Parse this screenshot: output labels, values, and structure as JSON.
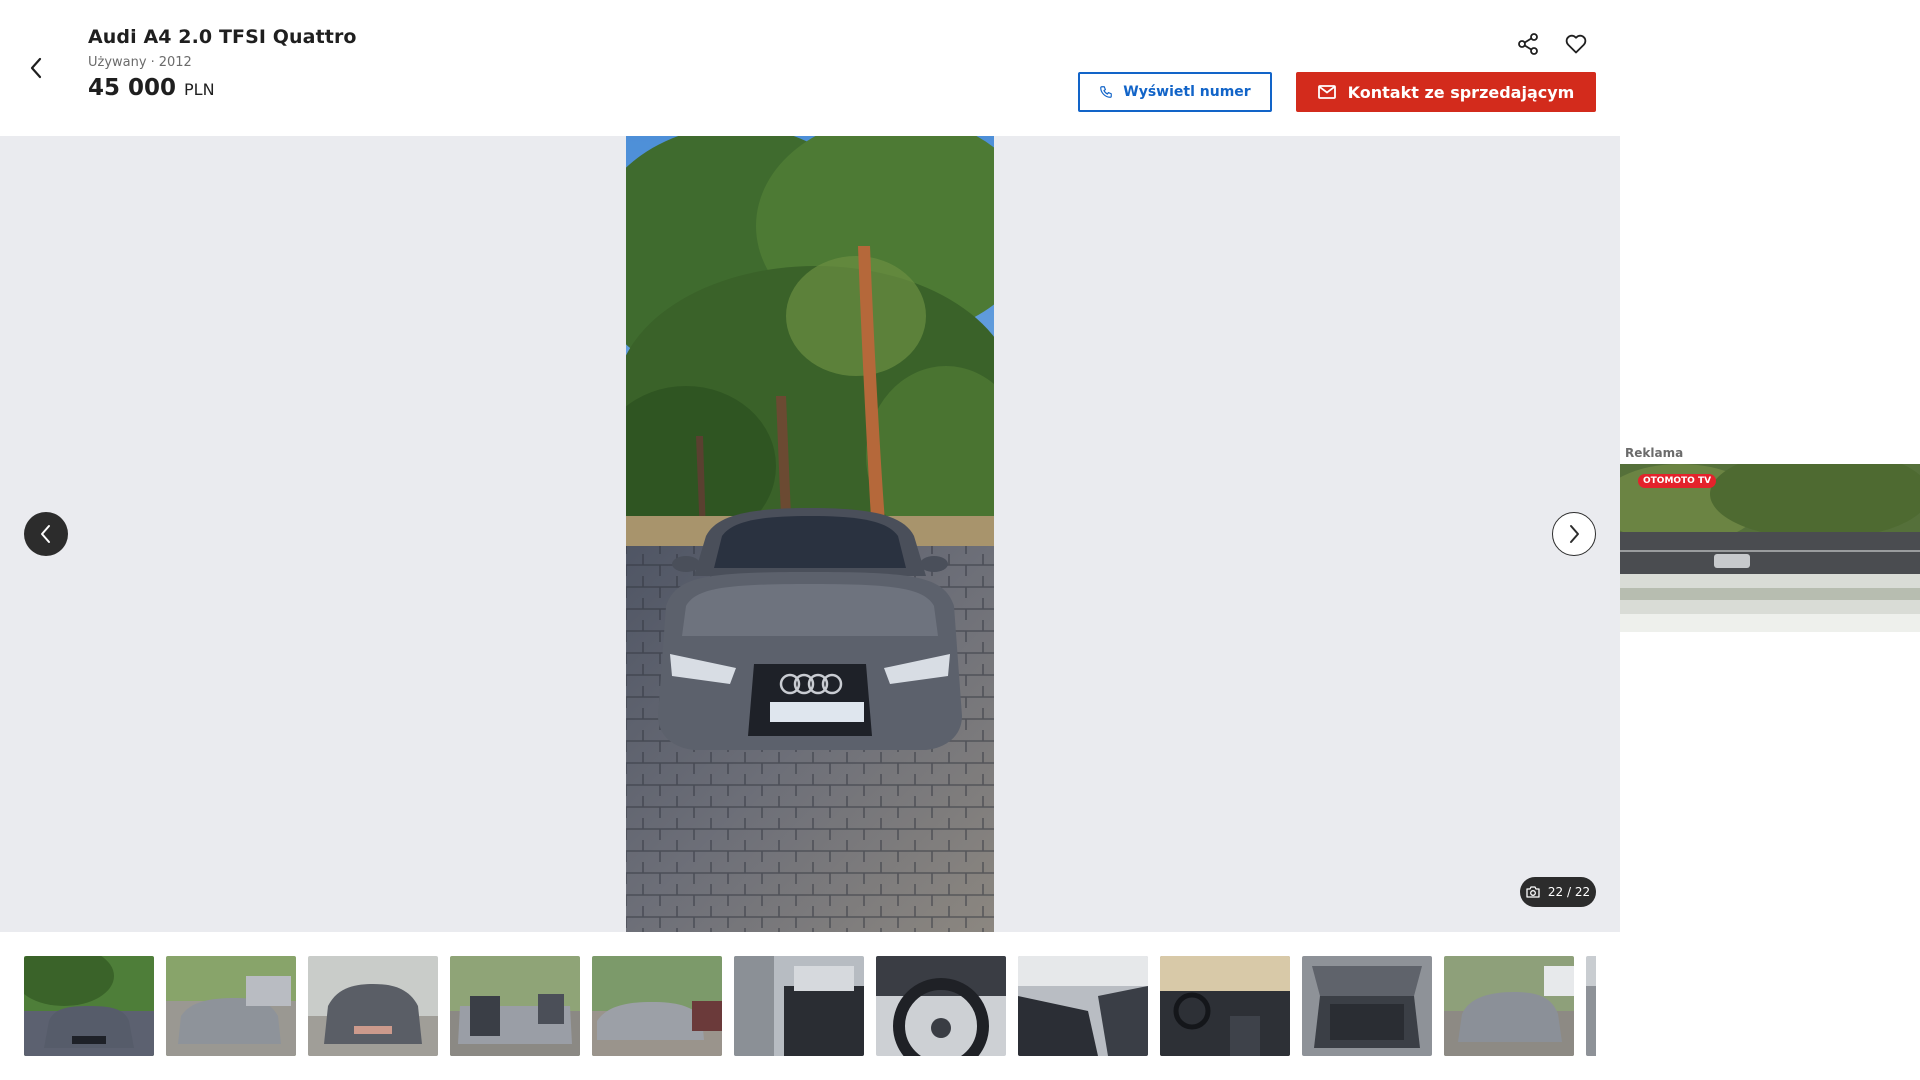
{
  "header": {
    "title": "Audi A4 2.0 TFSI Quattro",
    "condition": "Używany",
    "separator": "·",
    "year": "2012",
    "price": "45 000",
    "currency": "PLN",
    "back_icon": "chevron-left-icon",
    "share_icon": "share-icon",
    "favorite_icon": "heart-icon"
  },
  "actions": {
    "show_number_label": "Wyświetl numer",
    "show_number_icon": "phone-icon",
    "contact_label": "Kontakt ze sprzedającym",
    "contact_icon": "mail-icon"
  },
  "gallery": {
    "counter": "22 / 22",
    "counter_icon": "camera-icon",
    "prev_icon": "chevron-left-icon",
    "next_icon": "chevron-right-icon",
    "thumbnail_count": 12
  },
  "ad": {
    "label": "Reklama",
    "banner_logo": "OTOMOTO TV"
  },
  "colors": {
    "primary_blue": "#1264c8",
    "accent_red": "#d32b1c",
    "gallery_bg": "#eaebef",
    "text_dark": "#1f1f1f",
    "text_muted": "#6b6b6b"
  }
}
